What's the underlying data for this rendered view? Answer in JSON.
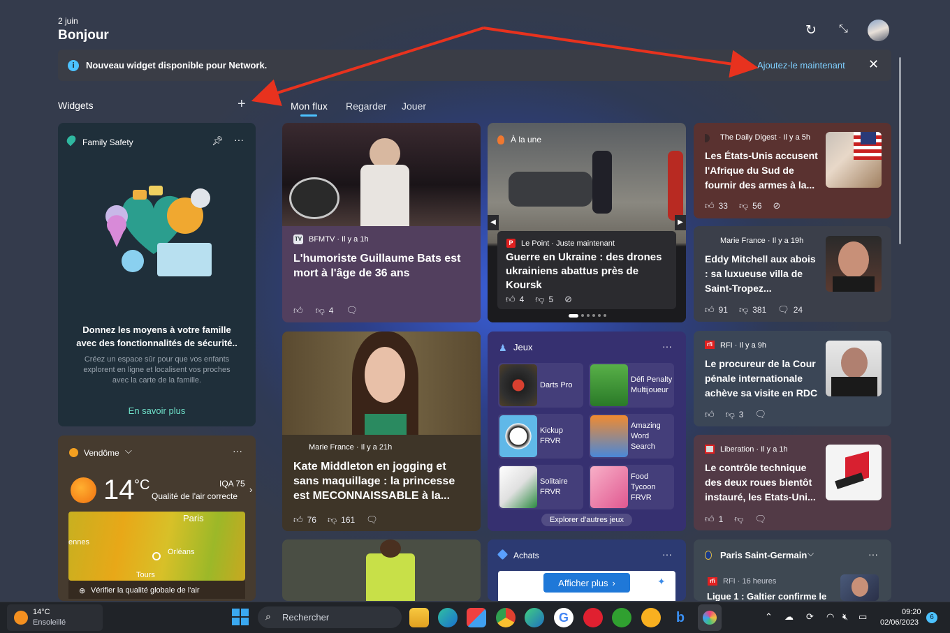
{
  "header": {
    "date": "2 juin",
    "greeting": "Bonjour"
  },
  "banner": {
    "text": "Nouveau widget disponible pour Network.",
    "link": "Ajoutez-le maintenant"
  },
  "widgets_label": "Widgets",
  "tabs": [
    "Mon flux",
    "Regarder",
    "Jouer"
  ],
  "family": {
    "title": "Family Safety",
    "headline": "Donnez les moyens à votre famille avec des fonctionnalités de sécurité..",
    "body": "Créez un espace sûr pour que vos enfants explorent en ligne et localisent vos proches avec la carte de la famille.",
    "link": "En savoir plus"
  },
  "weather": {
    "location": "Vendôme",
    "temp": "14",
    "unit": "°C",
    "iqa": "IQA 75",
    "quality": "Qualité de l'air correcte",
    "map_labels": [
      "Paris",
      "Orléans",
      "Tours",
      "ennes"
    ],
    "link": "Vérifier la qualité globale de l'air"
  },
  "news1": {
    "source": "BFMTV · Il y a 1h",
    "headline": "L'humoriste Guillaume Bats est mort à l'âge de 36 ans",
    "dislikes": "4"
  },
  "alaune": {
    "label": "À la une",
    "source": "Le Point · Juste maintenant",
    "headline": "Guerre en Ukraine : des drones ukrainiens abattus près de Koursk",
    "likes": "4",
    "dislikes": "5"
  },
  "kate": {
    "source": "Marie France · Il y a 21h",
    "headline": "Kate Middleton en jogging et sans maquillage : la princesse est MECONNAISSABLE à la...",
    "likes": "76",
    "dislikes": "161"
  },
  "jeux": {
    "title": "Jeux",
    "items": [
      "Darts Pro",
      "Défi Penalty Multijoueur",
      "Kickup FRVR",
      "Amazing Word Search",
      "Solitaire FRVR",
      "Food Tycoon FRVR"
    ],
    "more": "Explorer d'autres jeux"
  },
  "achats": {
    "title": "Achats",
    "button": "Afficher plus"
  },
  "right": [
    {
      "source": "The Daily Digest · Il y a 5h",
      "headline": "Les États-Unis accusent l'Afrique du Sud de fournir des armes à la...",
      "likes": "33",
      "dislikes": "56",
      "comments": ""
    },
    {
      "source": "Marie France · Il y a 19h",
      "headline": "Eddy Mitchell aux abois : sa luxueuse villa de Saint-Tropez...",
      "likes": "91",
      "dislikes": "381",
      "comments": "24"
    },
    {
      "source": "RFI · Il y a 9h",
      "headline": "Le procureur de la Cour pénale internationale achève sa visite en RDC",
      "likes": "",
      "dislikes": "3",
      "comments": ""
    },
    {
      "source": "Liberation · Il y a 1h",
      "headline": "Le contrôle technique des deux roues bientôt instauré, les Etats-Uni...",
      "likes": "1",
      "dislikes": "",
      "comments": ""
    }
  ],
  "psg": {
    "title": "Paris Saint-Germain",
    "source": "RFI · 16 heures",
    "headline": "Ligue 1 : Galtier confirme le"
  },
  "taskbar": {
    "temp": "14°C",
    "weather": "Ensoleillé",
    "search": "Rechercher",
    "time": "09:20",
    "date": "02/06/2023",
    "badge": "6"
  },
  "colors": {
    "accent": "#4cc2ff",
    "arrow": "#e8321e"
  }
}
